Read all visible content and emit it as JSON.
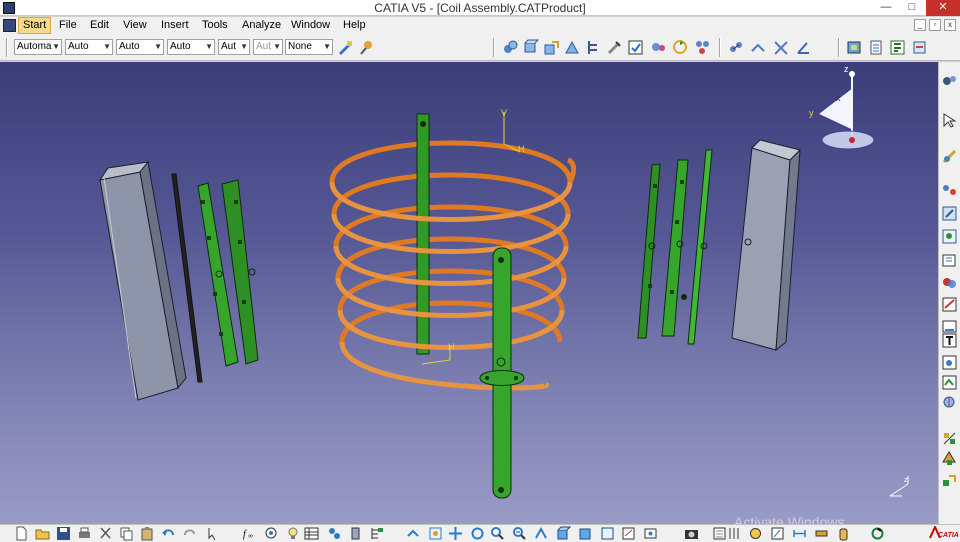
{
  "window": {
    "title": "CATIA V5 - [Coil Assembly.CATProduct]",
    "minimize_glyph": "—",
    "maximize_glyph": "□",
    "close_glyph": "✕"
  },
  "menu": {
    "items": [
      {
        "label": "Start"
      },
      {
        "label": "File"
      },
      {
        "label": "Edit"
      },
      {
        "label": "View"
      },
      {
        "label": "Insert"
      },
      {
        "label": "Tools"
      },
      {
        "label": "Analyze"
      },
      {
        "label": "Window"
      },
      {
        "label": "Help"
      }
    ],
    "mdi_minimize": "_",
    "mdi_restore": "▫",
    "mdi_close": "x"
  },
  "graphic_properties": {
    "fill_color": "Automa",
    "line_color": "Auto",
    "line_thickness": "Auto",
    "line_type": "Auto",
    "point_symbol": "Aut",
    "render_style": "Aut",
    "layer": "None"
  },
  "viewport": {
    "watermark": "Activate Windows",
    "compass_axis_x": "x",
    "compass_axis_y": "y",
    "compass_axis_z": "z",
    "axis_label_v": "V",
    "axis_label_h": "H",
    "colors": {
      "coil": "#e07a22",
      "bracket_green": "#35a62b",
      "plate_gray": "#8f95a8",
      "background_top": "#3a3d78",
      "background_bottom": "#9a9bc6",
      "axis_yellow": "#e4d23a"
    }
  },
  "bottom": {
    "brand": "CATIA"
  }
}
